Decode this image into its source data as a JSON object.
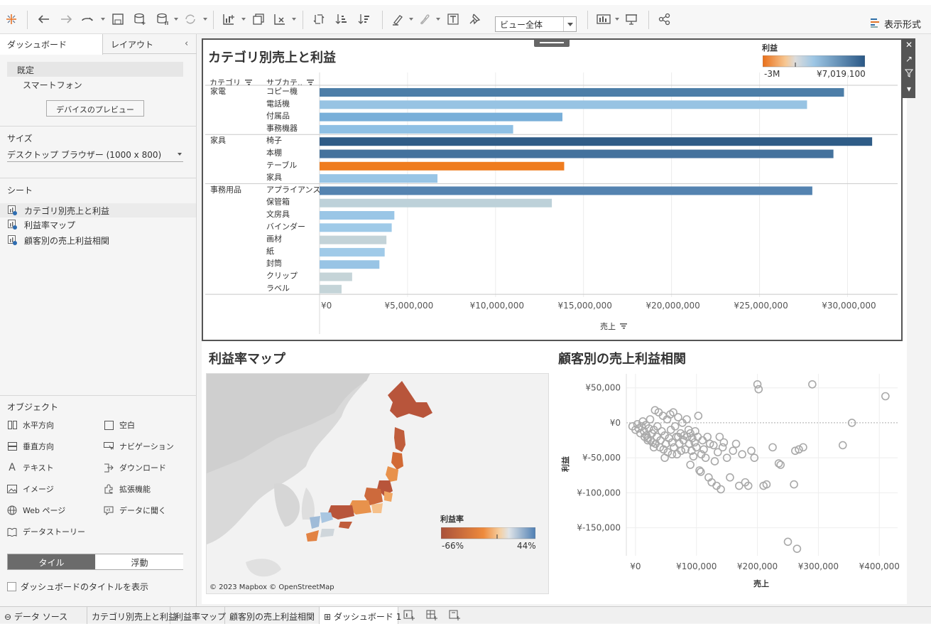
{
  "toolbar": {
    "view_select": "ビュー全体",
    "show_me": "表示形式"
  },
  "left_panel": {
    "tab_dashboard": "ダッシュボード",
    "tab_layout": "レイアウト",
    "device_default": "既定",
    "device_phone": "スマートフォン",
    "preview_button": "デバイスのプレビュー",
    "size_title": "サイズ",
    "size_value": "デスクトップ ブラウザー (1000 x 800)",
    "sheets_title": "シート",
    "sheets": [
      "カテゴリ別売上と利益",
      "利益率マップ",
      "顧客別の売上利益相関"
    ],
    "objects_title": "オブジェクト",
    "objects": [
      "水平方向",
      "空白",
      "垂直方向",
      "ナビゲーション",
      "テキスト",
      "ダウンロード",
      "イメージ",
      "拡張機能",
      "Web ページ",
      "データに聞く",
      "データストーリー"
    ],
    "tile": "タイル",
    "float": "浮動",
    "show_title": "ダッシュボードのタイトルを表示"
  },
  "bar_chart": {
    "title": "カテゴリ別売上と利益",
    "col_category": "カテゴリ",
    "col_subcategory": "サブカテ..",
    "xlabel": "売上",
    "legend_title": "利益",
    "legend_min": "-3M",
    "legend_max": "¥7,019,100",
    "ticks": [
      "¥0",
      "¥5,000,000",
      "¥10,000,000",
      "¥15,000,000",
      "¥20,000,000",
      "¥25,000,000",
      "¥30,000,000"
    ]
  },
  "map": {
    "title": "利益率マップ",
    "legend_title": "利益率",
    "legend_min": "-66%",
    "legend_max": "44%",
    "copyright": "© 2023 Mapbox © OpenStreetMap"
  },
  "scatter": {
    "title": "顧客別の売上利益相関",
    "ylabel": "利益",
    "xlabel": "売上",
    "xticks": [
      "¥0",
      "¥100,000",
      "¥200,000",
      "¥300,000",
      "¥400,000"
    ],
    "yticks": [
      "¥50,000",
      "¥0",
      "¥-50,000",
      "¥-100,000",
      "¥-150,000"
    ]
  },
  "bottom_tabs": [
    "データ ソース",
    "カテゴリ別売上と利益",
    "利益率マップ",
    "顧客別の売上利益相関",
    "ダッシュボード 1"
  ],
  "chart_data": [
    {
      "type": "bar",
      "title": "カテゴリ別売上と利益",
      "xlabel": "売上",
      "xlim": [
        0,
        32000000
      ],
      "groups": [
        {
          "category": "家電",
          "items": [
            {
              "sub": "コピー機",
              "sales": 29800000,
              "color": "#4d7ea8"
            },
            {
              "sub": "電話機",
              "sales": 27700000,
              "color": "#97c3e3"
            },
            {
              "sub": "付属品",
              "sales": 13800000,
              "color": "#79afd9"
            },
            {
              "sub": "事務機器",
              "sales": 11000000,
              "color": "#8fc0e4"
            }
          ]
        },
        {
          "category": "家具",
          "items": [
            {
              "sub": "椅子",
              "sales": 31400000,
              "color": "#2f5c87"
            },
            {
              "sub": "本棚",
              "sales": 29200000,
              "color": "#44729d"
            },
            {
              "sub": "テーブル",
              "sales": 13900000,
              "color": "#ef7c1f"
            },
            {
              "sub": "家具",
              "sales": 6700000,
              "color": "#99c5e5"
            }
          ]
        },
        {
          "category": "事務用品",
          "items": [
            {
              "sub": "アプライアンス",
              "sales": 28000000,
              "color": "#5483b0"
            },
            {
              "sub": "保管箱",
              "sales": 13200000,
              "color": "#bdd1d9"
            },
            {
              "sub": "文房具",
              "sales": 4250000,
              "color": "#9ac6e6"
            },
            {
              "sub": "バインダー",
              "sales": 4100000,
              "color": "#9fcae8"
            },
            {
              "sub": "画材",
              "sales": 3800000,
              "color": "#c3d3d8"
            },
            {
              "sub": "紙",
              "sales": 3700000,
              "color": "#a0cae8"
            },
            {
              "sub": "封筒",
              "sales": 3400000,
              "color": "#98c4e5"
            },
            {
              "sub": "クリップ",
              "sales": 1850000,
              "color": "#c5d4d8"
            },
            {
              "sub": "ラベル",
              "sales": 1250000,
              "color": "#c4d4d8"
            }
          ]
        }
      ]
    },
    {
      "type": "scatter",
      "title": "顧客別の売上利益相関",
      "xlabel": "売上",
      "ylabel": "利益",
      "xlim": [
        -15000,
        430000
      ],
      "ylim": [
        -190000,
        70000
      ],
      "points": [
        [
          -5000,
          -5000
        ],
        [
          0,
          -10000
        ],
        [
          3000,
          -2000
        ],
        [
          5000,
          -8000
        ],
        [
          8000,
          -15000
        ],
        [
          10000,
          -5000
        ],
        [
          12000,
          2000
        ],
        [
          14000,
          -12000
        ],
        [
          15000,
          -20000
        ],
        [
          17000,
          -3000
        ],
        [
          18000,
          -18000
        ],
        [
          20000,
          -22000
        ],
        [
          22000,
          -8000
        ],
        [
          24000,
          5000
        ],
        [
          25000,
          -25000
        ],
        [
          27000,
          -15000
        ],
        [
          28000,
          -28000
        ],
        [
          30000,
          -10000
        ],
        [
          32000,
          18000
        ],
        [
          33000,
          -30000
        ],
        [
          35000,
          -20000
        ],
        [
          36000,
          -5000
        ],
        [
          38000,
          15000
        ],
        [
          40000,
          -35000
        ],
        [
          41000,
          -25000
        ],
        [
          43000,
          -12000
        ],
        [
          45000,
          10000
        ],
        [
          46000,
          -38000
        ],
        [
          48000,
          -18000
        ],
        [
          50000,
          -30000
        ],
        [
          52000,
          5000
        ],
        [
          53000,
          -42000
        ],
        [
          55000,
          -22000
        ],
        [
          57000,
          12000
        ],
        [
          58000,
          -10000
        ],
        [
          60000,
          -28000
        ],
        [
          62000,
          15000
        ],
        [
          63000,
          -35000
        ],
        [
          65000,
          -5000
        ],
        [
          67000,
          -20000
        ],
        [
          68000,
          -45000
        ],
        [
          70000,
          8000
        ],
        [
          72000,
          -30000
        ],
        [
          74000,
          -15000
        ],
        [
          75000,
          -40000
        ],
        [
          77000,
          0
        ],
        [
          79000,
          -25000
        ],
        [
          80000,
          -18000
        ],
        [
          82000,
          -38000
        ],
        [
          84000,
          5000
        ],
        [
          85000,
          -20000
        ],
        [
          87000,
          -10000
        ],
        [
          88000,
          -30000
        ],
        [
          90000,
          -15000
        ],
        [
          92000,
          -40000
        ],
        [
          93000,
          -22000
        ],
        [
          95000,
          -48000
        ],
        [
          97000,
          -28000
        ],
        [
          98000,
          -12000
        ],
        [
          100000,
          -35000
        ],
        [
          102000,
          -20000
        ],
        [
          103000,
          10000
        ],
        [
          105000,
          -68000
        ],
        [
          107000,
          -70000
        ],
        [
          108000,
          -45000
        ],
        [
          110000,
          -25000
        ],
        [
          112000,
          -38000
        ],
        [
          115000,
          -50000
        ],
        [
          118000,
          -20000
        ],
        [
          120000,
          -78000
        ],
        [
          122000,
          -30000
        ],
        [
          125000,
          -85000
        ],
        [
          128000,
          -32000
        ],
        [
          130000,
          -55000
        ],
        [
          133000,
          -90000
        ],
        [
          135000,
          -42000
        ],
        [
          138000,
          -20000
        ],
        [
          140000,
          -95000
        ],
        [
          143000,
          -35000
        ],
        [
          145000,
          -28000
        ],
        [
          150000,
          -50000
        ],
        [
          155000,
          -78000
        ],
        [
          160000,
          -40000
        ],
        [
          165000,
          -30000
        ],
        [
          170000,
          -90000
        ],
        [
          175000,
          -45000
        ],
        [
          180000,
          -85000
        ],
        [
          185000,
          -90000
        ],
        [
          190000,
          -40000
        ],
        [
          195000,
          -50000
        ],
        [
          200000,
          55000
        ],
        [
          202000,
          48000
        ],
        [
          210000,
          -90000
        ],
        [
          215000,
          -88000
        ],
        [
          225000,
          -35000
        ],
        [
          235000,
          -58000
        ],
        [
          238000,
          -60000
        ],
        [
          250000,
          -170000
        ],
        [
          260000,
          -88000
        ],
        [
          262000,
          -40000
        ],
        [
          265000,
          -180000
        ],
        [
          268000,
          -38000
        ],
        [
          275000,
          -35000
        ],
        [
          290000,
          55000
        ],
        [
          340000,
          -32000
        ],
        [
          355000,
          0
        ],
        [
          410000,
          38000
        ],
        [
          60000,
          -45000
        ],
        [
          48000,
          -50000
        ],
        [
          30000,
          -35000
        ],
        [
          20000,
          -25000
        ],
        [
          90000,
          -60000
        ],
        [
          70000,
          -20000
        ]
      ]
    }
  ]
}
